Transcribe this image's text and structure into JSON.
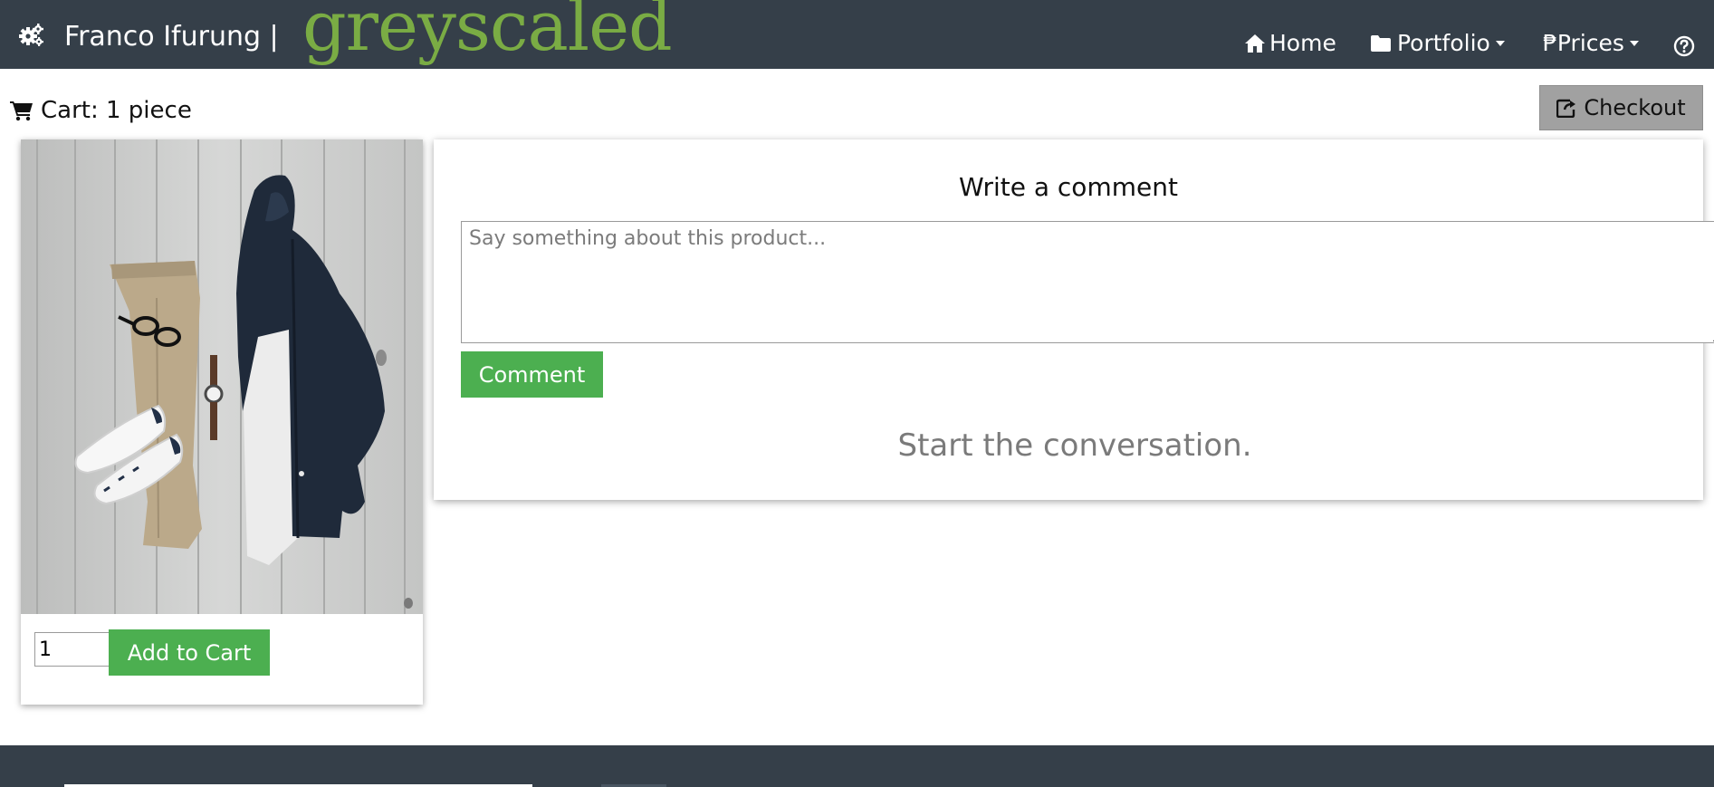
{
  "header": {
    "brand_name": "Franco Ifurung |",
    "brand_logo": "greyscaled",
    "brand_icon": "gears-icon",
    "nav": [
      {
        "label": "Home",
        "icon": "home-icon"
      },
      {
        "label": "Portfolio",
        "icon": "folder-icon",
        "dropdown": true
      },
      {
        "label": "₱Prices",
        "dropdown": true
      },
      {
        "label": "",
        "icon": "help-icon"
      }
    ]
  },
  "cart": {
    "status": "Cart: 1 piece",
    "icon": "cart-icon"
  },
  "checkout": {
    "label": "Checkout",
    "icon": "share-icon"
  },
  "product": {
    "image": "flat-lay-outfit-photo",
    "quantity": "1",
    "add_to_cart_label": "Add to Cart"
  },
  "comments": {
    "title": "Write a comment",
    "placeholder": "Say something about this product...",
    "button_label": "Comment",
    "empty_message": "Start the conversation."
  },
  "colors": {
    "navbar": "#353f49",
    "logo": "#7aac44",
    "button_green": "#4caf50",
    "checkout_gray": "#a1a1a1"
  }
}
